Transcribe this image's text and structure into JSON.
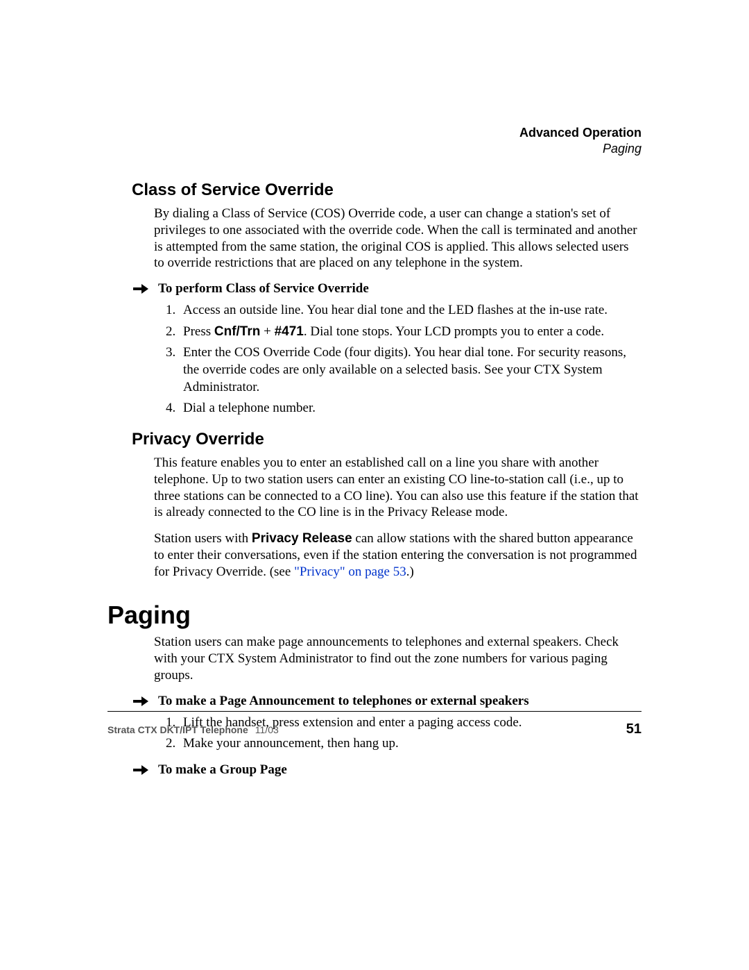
{
  "header": {
    "chapter": "Advanced Operation",
    "section": "Paging"
  },
  "sections": {
    "cos": {
      "title": "Class of Service Override",
      "intro": "By dialing a Class of Service (COS) Override code, a user can change a station's set of privileges to one associated with the override code. When the call is terminated and another is attempted from the same station, the original COS is applied. This allows selected users to override restrictions that are placed on any telephone in the system.",
      "proc_title": "To perform Class of Service Override",
      "steps": {
        "s1": "Access an outside line. You hear dial tone and the LED flashes at the in-use rate.",
        "s2_a": "Press ",
        "s2_cnf": "Cnf/Trn",
        "s2_b": " + ",
        "s2_code": "#471",
        "s2_c": ". Dial tone stops. Your LCD prompts you to enter a code.",
        "s3": "Enter the COS Override Code (four digits). You hear dial tone. For security reasons, the override codes are only available on a selected basis. See your CTX System Administrator.",
        "s4": "Dial a telephone number."
      }
    },
    "privacy": {
      "title": "Privacy Override",
      "p1": "This feature enables you to enter an established call on a line you share with another telephone. Up to two station users can enter an existing CO line-to-station call (i.e., up to three stations can be connected to a CO line). You can also use this feature if the station that is already connected to the CO line is in the Privacy Release mode.",
      "p2_a": "Station users with ",
      "p2_pr": "Privacy Release",
      "p2_b": " can allow stations with the shared button appearance to enter their conversations, even if the station entering the conversation is not programmed for Privacy Override. (see ",
      "p2_link": "\"Privacy\" on page 53",
      "p2_c": ".)"
    },
    "paging": {
      "title": "Paging",
      "intro": "Station users can make page announcements to telephones and external speakers. Check with your CTX System Administrator to find out the zone numbers for various paging groups.",
      "proc1_title": "To make a Page Announcement to telephones or external speakers",
      "proc1_steps": {
        "s1": "Lift the handset, press extension and enter a paging access code.",
        "s2": "Make your announcement, then hang up."
      },
      "proc2_title": "To make a Group Page"
    }
  },
  "footer": {
    "doc": "Strata CTX DKT/IPT Telephone",
    "date": "11/03",
    "page": "51"
  }
}
